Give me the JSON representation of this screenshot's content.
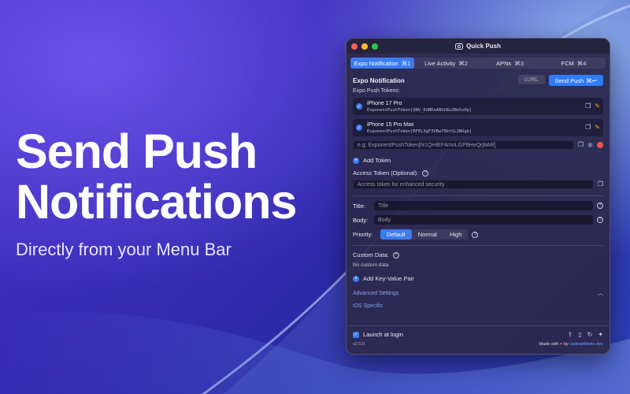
{
  "hero": {
    "title": "Send Push\nNotifications",
    "subtitle": "Directly from your Menu Bar"
  },
  "window": {
    "title": "Quick Push",
    "tabs": [
      {
        "label": "Expo Notification",
        "shortcut": "⌘1",
        "active": true
      },
      {
        "label": "Live Activity",
        "shortcut": "⌘2",
        "active": false
      },
      {
        "label": "APNs",
        "shortcut": "⌘3",
        "active": false
      },
      {
        "label": "FCM",
        "shortcut": "⌘4",
        "active": false
      }
    ],
    "section_title": "Expo Notification",
    "curl_label": "cURL",
    "send_label": "Send Push",
    "send_shortcut": "⌘↩",
    "push_tokens_label": "Expo Push Tokens:",
    "tokens": [
      {
        "name": "iPhone 17 Pro",
        "value": "ExponentPushToken[QNV_0dNRaANSb8u2NeSvOp]"
      },
      {
        "name": "iPhone 15 Pro Max",
        "value": "ExponentPushToken[RFEL3gF3VBw79btSLZWUgb]"
      }
    ],
    "token_placeholder": "e.g. ExponentPushToken[N1QHIEF4mnLGP8HeQrj9AR]",
    "add_token_label": "Add Token",
    "access_token_label": "Access Token (Optional):",
    "access_token_placeholder": "Access token for enhanced security",
    "title_label": "Title:",
    "title_placeholder": "Title",
    "body_label": "Body:",
    "body_placeholder": "Body",
    "priority_label": "Priority:",
    "priority_options": [
      "Default",
      "Normal",
      "High"
    ],
    "priority_selected": "Default",
    "custom_data_label": "Custom Data:",
    "no_custom_data": "No custom data",
    "add_kv_label": "Add Key-Value Pair",
    "advanced_label": "Advanced Settings",
    "ios_specific_label": "iOS Specific",
    "launch_at_login_label": "Launch at login",
    "launch_at_login_checked": true,
    "version": "v2.0.0",
    "made_with": "Made with",
    "by": "by",
    "site": "codewithbeto.dev"
  },
  "colors": {
    "accent": "#3b7cf0",
    "danger": "#ff4f4f",
    "warning": "#ff9f2e"
  }
}
